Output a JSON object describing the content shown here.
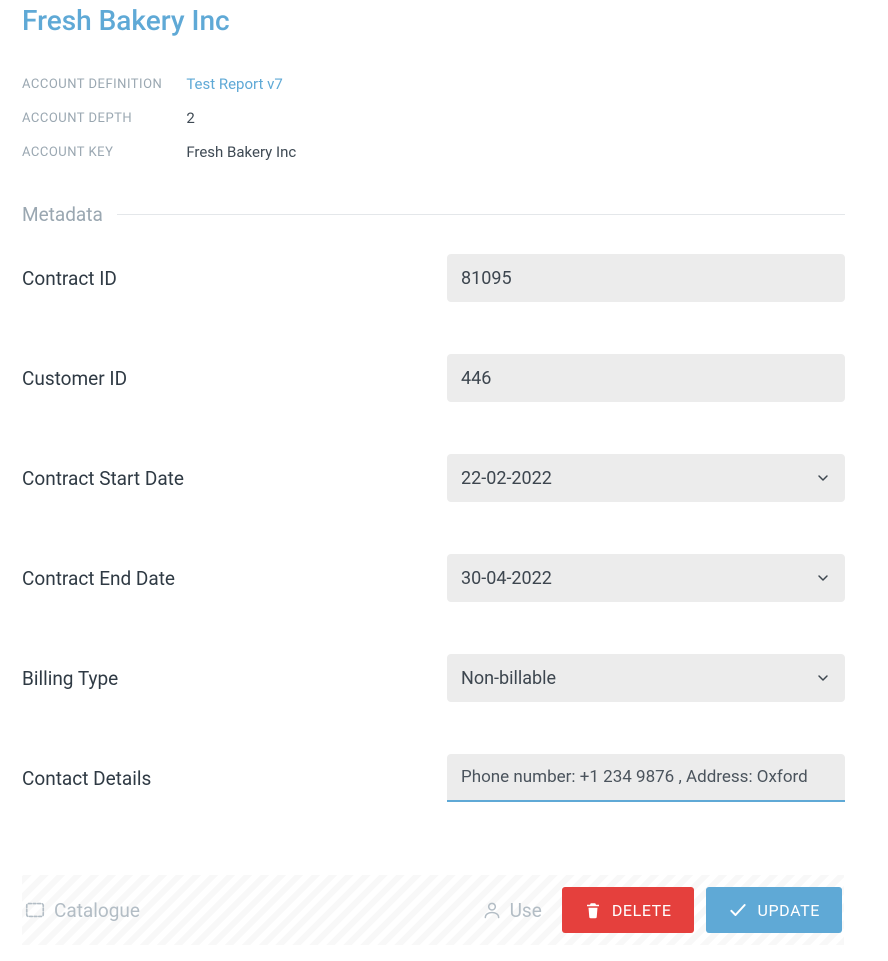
{
  "header": {
    "title": "Fresh Bakery Inc"
  },
  "account_info": {
    "definition_label": "ACCOUNT DEFINITION",
    "definition_value": "Test Report v7",
    "depth_label": "ACCOUNT DEPTH",
    "depth_value": "2",
    "key_label": "ACCOUNT KEY",
    "key_value": "Fresh Bakery Inc"
  },
  "section": {
    "metadata_title": "Metadata"
  },
  "fields": {
    "contract_id": {
      "label": "Contract ID",
      "value": "81095"
    },
    "customer_id": {
      "label": "Customer ID",
      "value": "446"
    },
    "contract_start": {
      "label": "Contract Start Date",
      "value": "22-02-2022"
    },
    "contract_end": {
      "label": "Contract End Date",
      "value": "30-04-2022"
    },
    "billing_type": {
      "label": "Billing Type",
      "value": "Non-billable"
    },
    "contact_details": {
      "label": "Contact Details",
      "value": "Phone number: +1 234 9876 , Address: Oxford"
    }
  },
  "footer": {
    "catalogue_label": "Catalogue",
    "user_label": "Use",
    "delete_label": "DELETE",
    "update_label": "UPDATE"
  }
}
